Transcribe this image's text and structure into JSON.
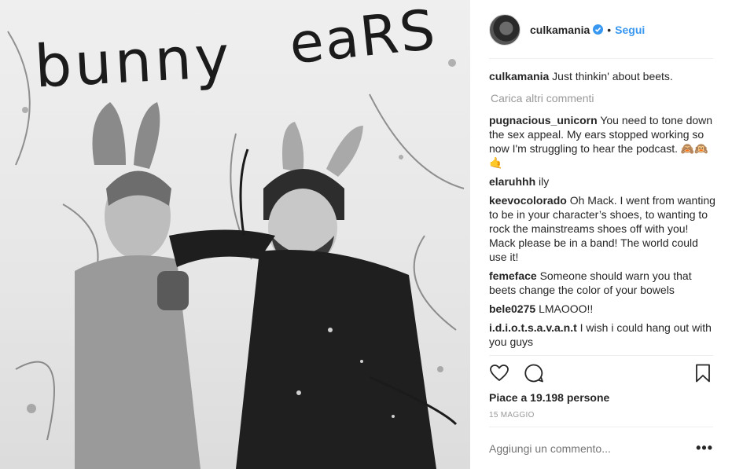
{
  "photo": {
    "text_line_1": "bunny",
    "text_line_2": "eaRS"
  },
  "header": {
    "username": "culkamania",
    "verified_icon": "verified-badge-icon",
    "separator": "•",
    "follow_label": "Segui"
  },
  "caption": {
    "username": "culkamania",
    "text": "Just thinkin' about beets."
  },
  "load_more_label": "Carica altri commenti",
  "comments": [
    {
      "username": "pugnacious_unicorn",
      "text": "You need to tone down the sex appeal. My ears stopped working so now I'm struggling to hear the podcast. 🙈🙉🤙"
    },
    {
      "username": "elaruhhh",
      "text": "ily"
    },
    {
      "username": "keevocolorado",
      "text": "Oh Mack. I went from wanting to be in your character’s shoes, to wanting to rock the mainstreams shoes off with you! Mack please be in a band! The world could use it!"
    },
    {
      "username": "femeface",
      "text": "Someone should warn you that beets change the color of your bowels"
    },
    {
      "username": "bele0275",
      "text": "LMAOOO!!"
    },
    {
      "username": "i.d.i.o.t.s.a.v.a.n.t",
      "text": "I wish i could hang out with you guys"
    }
  ],
  "actions": {
    "like_icon": "heart-icon",
    "comment_icon": "comment-bubble-icon",
    "save_icon": "bookmark-icon"
  },
  "likes_text": "Piace a 19.198 persone",
  "date_text": "15 MAGGIO",
  "add_comment_placeholder": "Aggiungi un commento...",
  "more_label": "•••",
  "colors": {
    "accent": "#3897f0",
    "text": "#262626",
    "muted": "#999999",
    "divider": "#efefef"
  }
}
